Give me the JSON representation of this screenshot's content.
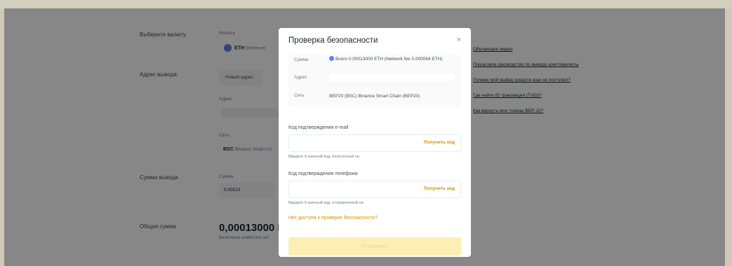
{
  "form": {
    "currency_label": "Выберите валюту",
    "coin_label": "Монета",
    "coin_symbol": "ETH",
    "coin_name": "Ethereum",
    "address_label": "Адрес вывода:",
    "new_address_button": "Новый адрес",
    "address_field_label": "Адрес",
    "network_label": "Сеть",
    "network_symbol": "BSC",
    "network_name": "Binance Smart Ch",
    "amount_label": "Сумма вывода",
    "amount_field_label": "Сумма",
    "amount_value": "0.00013",
    "total_label": "Общая сумма",
    "total_value": "0,00013000 E",
    "total_note": "Включена комиссия сет"
  },
  "faq": [
    "Обучающее видео",
    "Пошаговое руководство по выводу криптовалюты",
    "Почему мой вывод средств еще не поступил?",
    "Где найти ID транзакции (TxID)?",
    "Как вернуть мои токены BEP-20?"
  ],
  "modal": {
    "title": "Проверка безопасности",
    "close_symbol": "×",
    "summary": {
      "amount_label": "Сумма",
      "amount_value": "Всего 0.00013000 ETH (Network fee 0.000064 ETH)",
      "address_label": "Адрес",
      "network_label": "Сеть",
      "network_value": "BEP20 (BSC) Binance Smart Chain (BEP20)"
    },
    "email_label": "Код подтверждения e-mail",
    "email_get_code": "Получить код",
    "email_hint": "Введите 6-значный код, полученный на",
    "phone_label": "Код подтверждения телефона",
    "phone_get_code": "Получить код",
    "phone_hint": "Введите 6-значный код, отправленный на",
    "no_access_link": "Нет доступа к проверке безопасности?",
    "submit_label": "Отправить"
  },
  "colors": {
    "accent": "#c99400",
    "eth": "#627eea",
    "submit_disabled_bg": "#fcefb4"
  }
}
